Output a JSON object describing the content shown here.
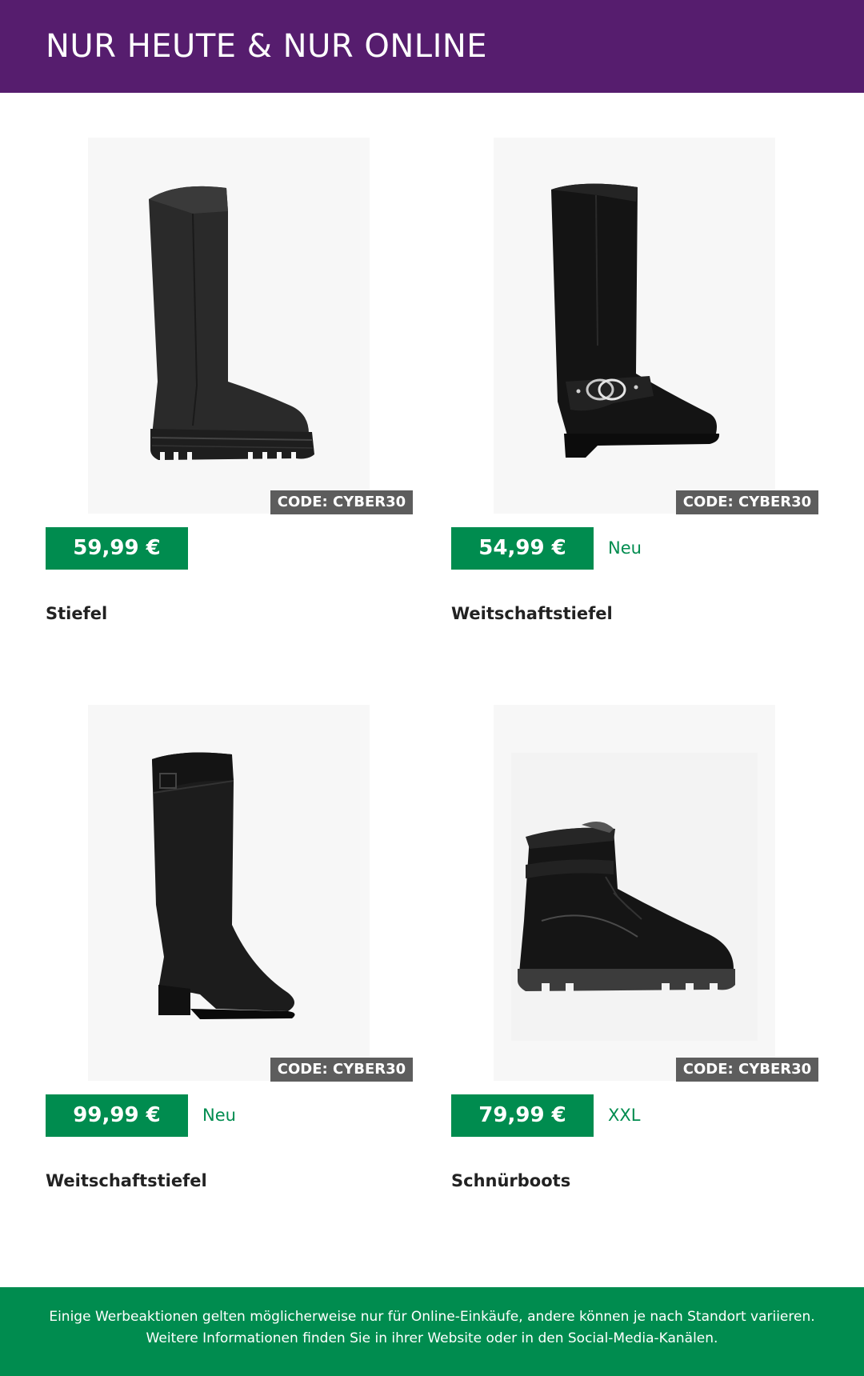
{
  "header": {
    "title": "NUR HEUTE & NUR ONLINE"
  },
  "colors": {
    "header_bg": "#561d6e",
    "accent_green": "#008c4f",
    "badge_gray": "#5d5d5d"
  },
  "products": [
    {
      "name": "Stiefel",
      "price": "59,99 €",
      "code": "CODE: CYBER30",
      "tag": "",
      "image_icon": "tall-platform-boot-image"
    },
    {
      "name": "Weitschaftstiefel",
      "price": "54,99 €",
      "code": "CODE: CYBER30",
      "tag": "Neu",
      "image_icon": "tall-suede-boot-with-buckle-image"
    },
    {
      "name": "Weitschaftstiefel",
      "price": "99,99 €",
      "code": "CODE: CYBER30",
      "tag": "Neu",
      "image_icon": "tall-heeled-leather-boot-image"
    },
    {
      "name": "Schnürboots",
      "price": "79,99 €",
      "code": "CODE: CYBER30",
      "tag": "XXL",
      "image_icon": "lace-up-patent-boot-image"
    }
  ],
  "footer": {
    "disclaimer": "Einige Werbeaktionen gelten möglicherweise nur für Online-Einkäufe, andere können je nach Standort variieren. Weitere Informationen finden Sie in ihrer Website oder in den Social-Media-Kanälen."
  }
}
